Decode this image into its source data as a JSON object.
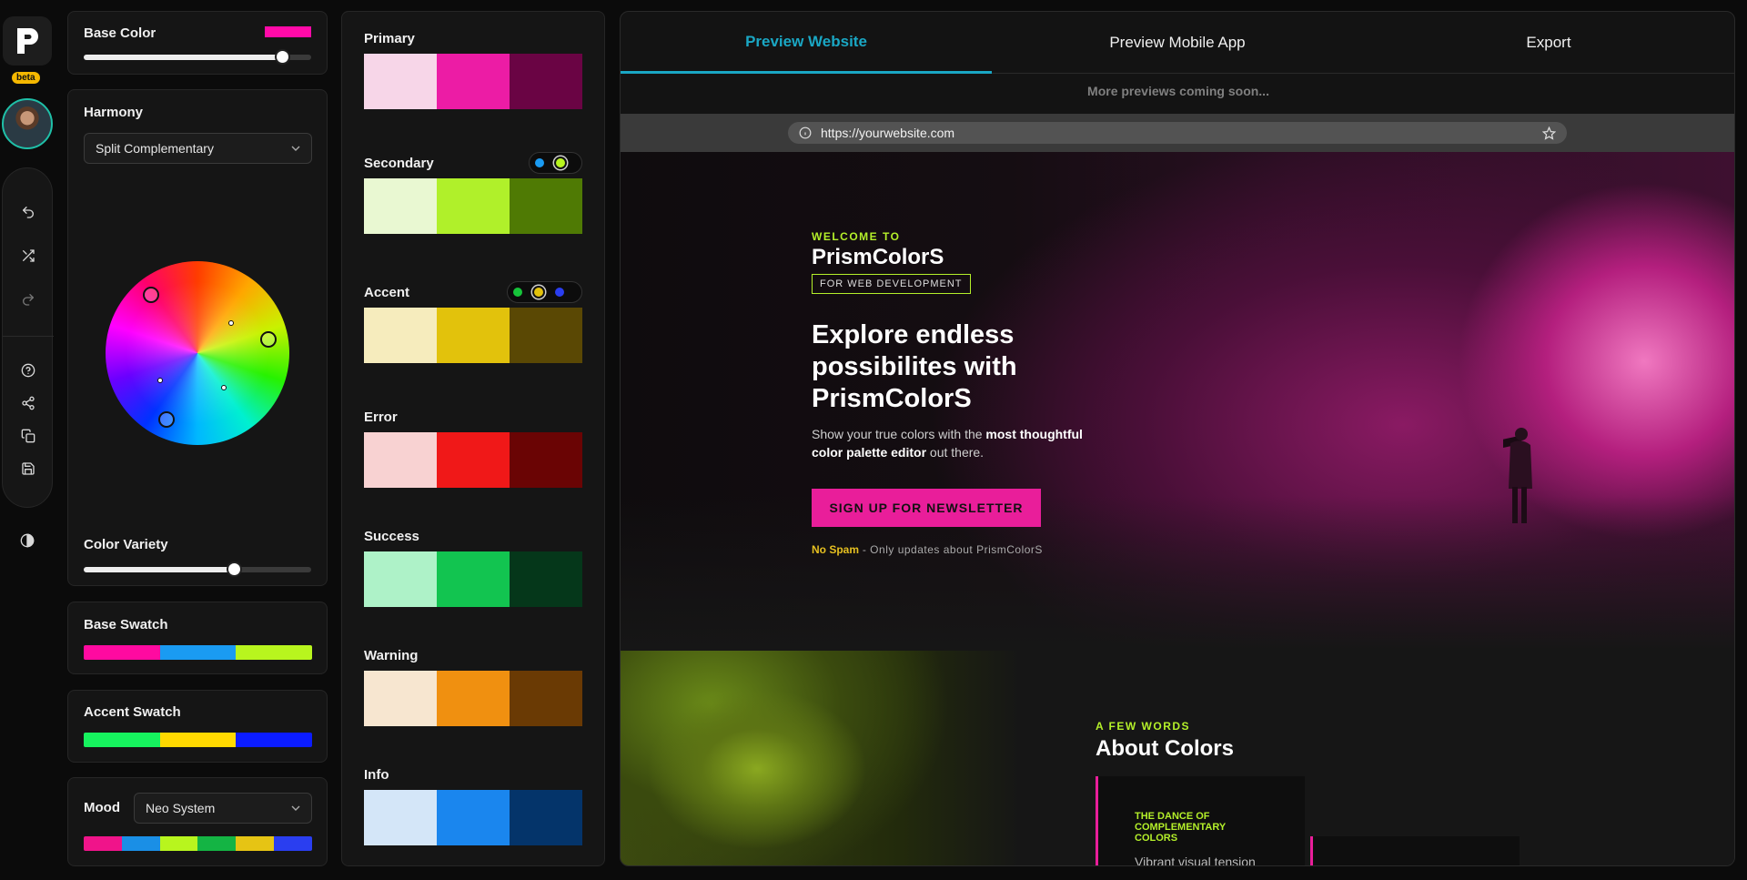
{
  "rail": {
    "beta": "beta"
  },
  "base_color": {
    "title": "Base Color",
    "swatch": "#ff0aa8",
    "level": 0.87
  },
  "harmony": {
    "title": "Harmony",
    "selected": "Split Complementary"
  },
  "color_variety": {
    "title": "Color Variety",
    "level": 0.66
  },
  "base_swatch": {
    "title": "Base Swatch",
    "colors": [
      "#ff0aa0",
      "#1a9bf2",
      "#b8f51e"
    ]
  },
  "accent_swatch": {
    "title": "Accent Swatch",
    "colors": [
      "#16f25e",
      "#ffd900",
      "#0b1cff"
    ]
  },
  "mood": {
    "title": "Mood",
    "selected": "Neo System",
    "colors": [
      "#f0148a",
      "#1a8fe6",
      "#b8f51e",
      "#14b444",
      "#e6c414",
      "#2a3ef0"
    ]
  },
  "palette": [
    {
      "name": "Primary",
      "shades": [
        "#f7d6e8",
        "#ec1ca5",
        "#6a0444"
      ]
    },
    {
      "name": "Secondary",
      "shades": [
        "#e9f8d2",
        "#b0f02a",
        "#4f7a04"
      ],
      "toggle": [
        "#1a9bf2",
        "#b8f51e"
      ]
    },
    {
      "name": "Accent",
      "shades": [
        "#f6ecbd",
        "#e2c20c",
        "#5a4804"
      ],
      "toggle": [
        "#16c43a",
        "#e2c20c",
        "#2a3ef0"
      ]
    },
    {
      "name": "Error",
      "shades": [
        "#f8d2d2",
        "#f01818",
        "#6a0404"
      ]
    },
    {
      "name": "Success",
      "shades": [
        "#aef2c8",
        "#12c450",
        "#05371a"
      ]
    },
    {
      "name": "Warning",
      "shades": [
        "#f7e6d0",
        "#f09010",
        "#6a3a04"
      ]
    },
    {
      "name": "Info",
      "shades": [
        "#d4e6f8",
        "#1a86ee",
        "#04346a"
      ]
    }
  ],
  "preview": {
    "tabs": [
      "Preview Website",
      "Preview Mobile App",
      "Export"
    ],
    "coming_soon": "More previews coming soon...",
    "url": "https://yourwebsite.com",
    "hero": {
      "welcome": "WELCOME TO",
      "brand": "PrismColorS",
      "tag": "FOR WEB DEVELOPMENT",
      "headline": "Explore endless possibilites with PrismColorS",
      "sub_pre": "Show your true colors with the ",
      "sub_bold": "most thoughtful color palette editor",
      "sub_post": " out there.",
      "cta": "SIGN UP FOR NEWSLETTER",
      "nospam": "No Spam",
      "nospam_note": " - Only updates about PrismColorS"
    },
    "about": {
      "kicker": "A FEW WORDS",
      "title": "About Colors",
      "card_title": "THE DANCE OF COMPLEMENTARY COLORS",
      "card_desc": "Vibrant visual tension"
    }
  }
}
